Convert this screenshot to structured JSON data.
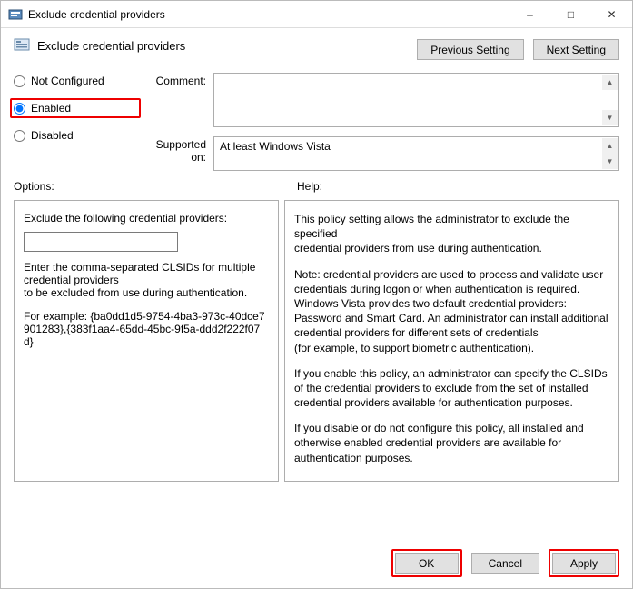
{
  "window": {
    "title": "Exclude credential providers"
  },
  "header": {
    "title": "Exclude credential providers",
    "prev": "Previous Setting",
    "next": "Next Setting"
  },
  "radios": {
    "not_configured": "Not Configured",
    "enabled": "Enabled",
    "disabled": "Disabled"
  },
  "labels": {
    "comment": "Comment:",
    "supported": "Supported on:",
    "options": "Options:",
    "help": "Help:"
  },
  "supported_text": "At least Windows Vista",
  "options": {
    "field_label": "Exclude the following credential providers:",
    "value": "",
    "hint1": "Enter the comma-separated CLSIDs for multiple credential  providers",
    "hint2": "to be excluded from use during authentication.",
    "example_label": "For example: {ba0dd1d5-9754-4ba3-973c-40dce7901283},{383f1aa4-65dd-45bc-9f5a-ddd2f222f07d}"
  },
  "help": {
    "p1": "This policy setting allows the administrator to exclude the specified\ncredential providers from use during authentication.",
    "p2": "Note: credential providers are used to process and validate user credentials during logon or when authentication is required. Windows Vista provides two default credential providers: Password and Smart Card. An administrator can install additional credential providers for different sets of credentials\n(for example, to support biometric authentication).",
    "p3": "If you enable this policy, an administrator can specify the CLSIDs of the credential providers to exclude from the set of installed credential providers available for authentication purposes.",
    "p4": "If you disable or do not configure this policy, all installed and otherwise enabled credential providers are available for authentication purposes."
  },
  "footer": {
    "ok": "OK",
    "cancel": "Cancel",
    "apply": "Apply"
  }
}
